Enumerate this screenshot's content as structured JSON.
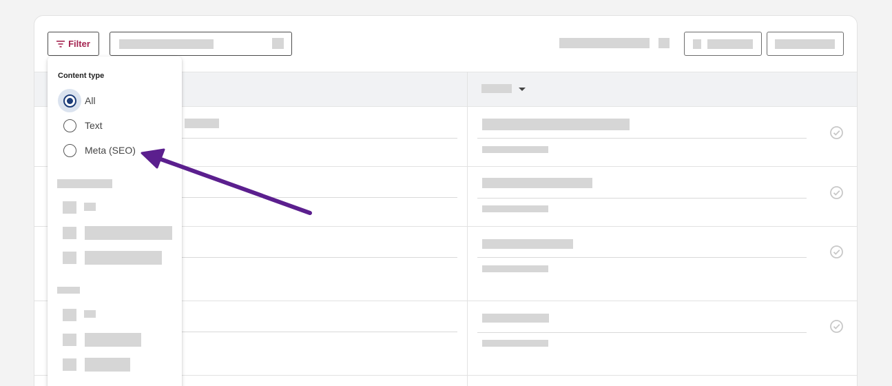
{
  "toolbar": {
    "filter_label": "Filter"
  },
  "filter_dropdown": {
    "section_title": "Content type",
    "options": [
      {
        "label": "All",
        "selected": true
      },
      {
        "label": "Text",
        "selected": false
      },
      {
        "label": "Meta (SEO)",
        "selected": false
      }
    ]
  },
  "icons": {
    "filter": "filter-icon",
    "caret": "caret-down-icon",
    "check": "check-circle-icon"
  },
  "colors": {
    "filter_accent": "#a3234f",
    "radio_selected": "#1c3c78",
    "annotation_arrow": "#5b1f8e"
  }
}
